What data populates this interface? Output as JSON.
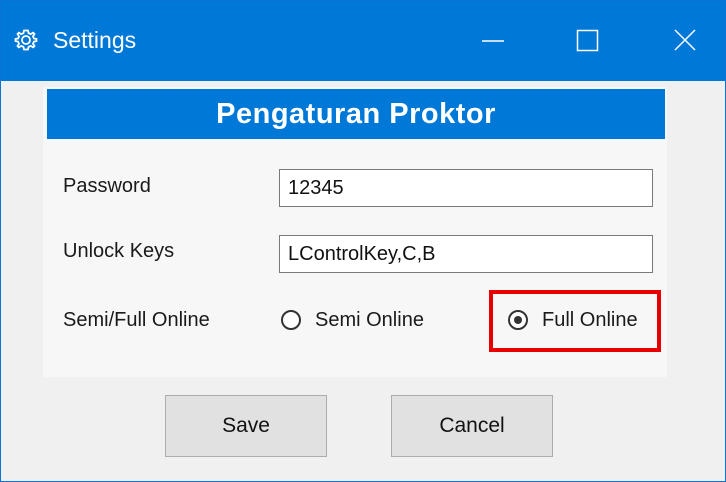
{
  "window": {
    "title": "Settings",
    "title_icon": "gear-icon",
    "controls": [
      "minimize-icon",
      "maximize-icon",
      "close-icon"
    ]
  },
  "banner": {
    "title": "Pengaturan Proktor"
  },
  "form": {
    "password": {
      "label": "Password",
      "value": "12345"
    },
    "unlock_keys": {
      "label": "Unlock Keys",
      "value": "LControlKey,C,B"
    },
    "mode": {
      "label": "Semi/Full Online",
      "options": [
        {
          "label": "Semi Online",
          "selected": false
        },
        {
          "label": "Full Online",
          "selected": true
        }
      ]
    }
  },
  "buttons": {
    "save_label": "Save",
    "cancel_label": "Cancel"
  },
  "colors": {
    "accent": "#0078d7",
    "highlight": "#e80000",
    "background": "#f0f0f0"
  }
}
